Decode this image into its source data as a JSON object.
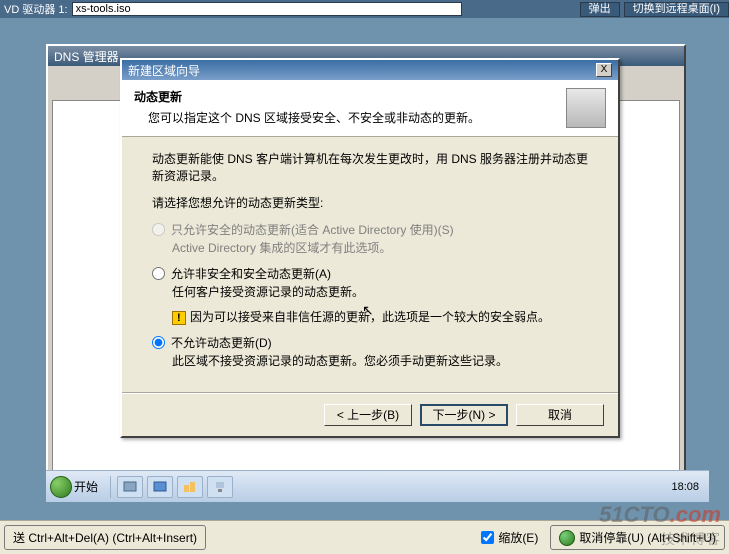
{
  "vm_top": {
    "drive_label": "VD 驱动器 1:",
    "drive_value": "xs-tools.iso",
    "eject": "弹出",
    "switch_remote": "切换到远程桌面(I)"
  },
  "dns_window": {
    "title": "DNS 管理器"
  },
  "wizard": {
    "title": "新建区域向导",
    "close_x": "X",
    "head_title": "动态更新",
    "head_sub": "您可以指定这个 DNS 区域接受安全、不安全或非动态的更新。",
    "intro1": "动态更新能使 DNS 客户端计算机在每次发生更改时，用 DNS 服务器注册并动态更新资源记录。",
    "intro2": "请选择您想允许的动态更新类型:",
    "opt1_label": "只允许安全的动态更新(适合 Active Directory 使用)(S)",
    "opt1_sub": "Active Directory 集成的区域才有此选项。",
    "opt2_label": "允许非安全和安全动态更新(A)",
    "opt2_sub1": "任何客户接受资源记录的动态更新。",
    "opt2_sub2": "因为可以接受来自非信任源的更新，此选项是一个较大的安全弱点。",
    "opt3_label": "不允许动态更新(D)",
    "opt3_sub": "此区域不接受资源记录的动态更新。您必须手动更新这些记录。",
    "btn_back": "< 上一步(B)",
    "btn_next": "下一步(N) >",
    "btn_cancel": "取消"
  },
  "taskbar": {
    "start": "开始",
    "time": "18:08"
  },
  "hostbar": {
    "send_cad": "送 Ctrl+Alt+Del(A) (Ctrl+Alt+Insert)",
    "scale": "缩放(E)",
    "undock": "取消停靠(U) (Alt+Shift+U)"
  },
  "watermark": {
    "main": "51CTO",
    "dot": ".com",
    "sub": "技术博客"
  }
}
